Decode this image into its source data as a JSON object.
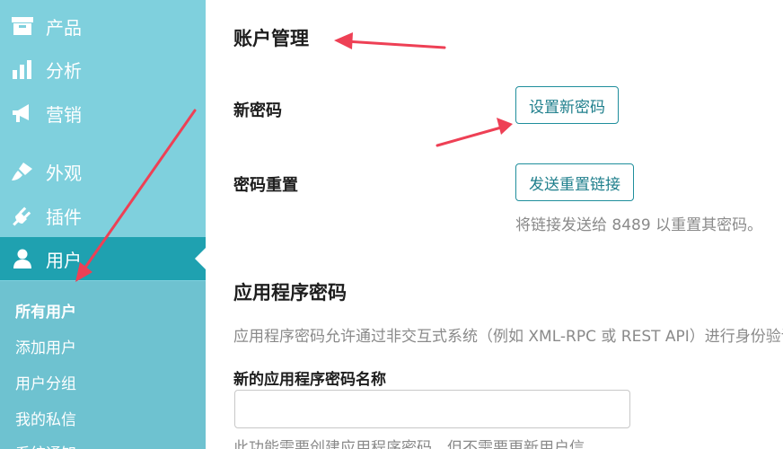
{
  "sidebar": {
    "items": [
      {
        "label": "产品",
        "icon": "archive-icon"
      },
      {
        "label": "分析",
        "icon": "bar-chart-icon"
      },
      {
        "label": "营销",
        "icon": "megaphone-icon"
      },
      {
        "label": "外观",
        "icon": "brush-icon"
      },
      {
        "label": "插件",
        "icon": "plug-icon"
      },
      {
        "label": "用户",
        "icon": "user-icon",
        "active": true
      }
    ],
    "submenu": [
      "所有用户",
      "添加用户",
      "用户分组",
      "我的私信",
      "系统通知"
    ]
  },
  "account": {
    "title": "账户管理",
    "new_password_label": "新密码",
    "set_password_button": "设置新密码",
    "reset_label": "密码重置",
    "send_reset_button": "发送重置链接",
    "reset_desc": "将链接发送给 8489 以重置其密码。"
  },
  "app_passwords": {
    "title": "应用程序密码",
    "desc": "应用程序密码允许通过非交互式系统（例如 XML-RPC 或 REST API）进行身份验证",
    "name_label": "新的应用程序密码名称",
    "name_value": "",
    "note": "此功能需要创建应用程序密码，但不需要更新用户信"
  },
  "colors": {
    "sidebar_bg": "#7fd0dd",
    "active_bg": "#1fa1b0",
    "accent": "#1f8e9c",
    "annotation_arrow": "#ee4055"
  }
}
